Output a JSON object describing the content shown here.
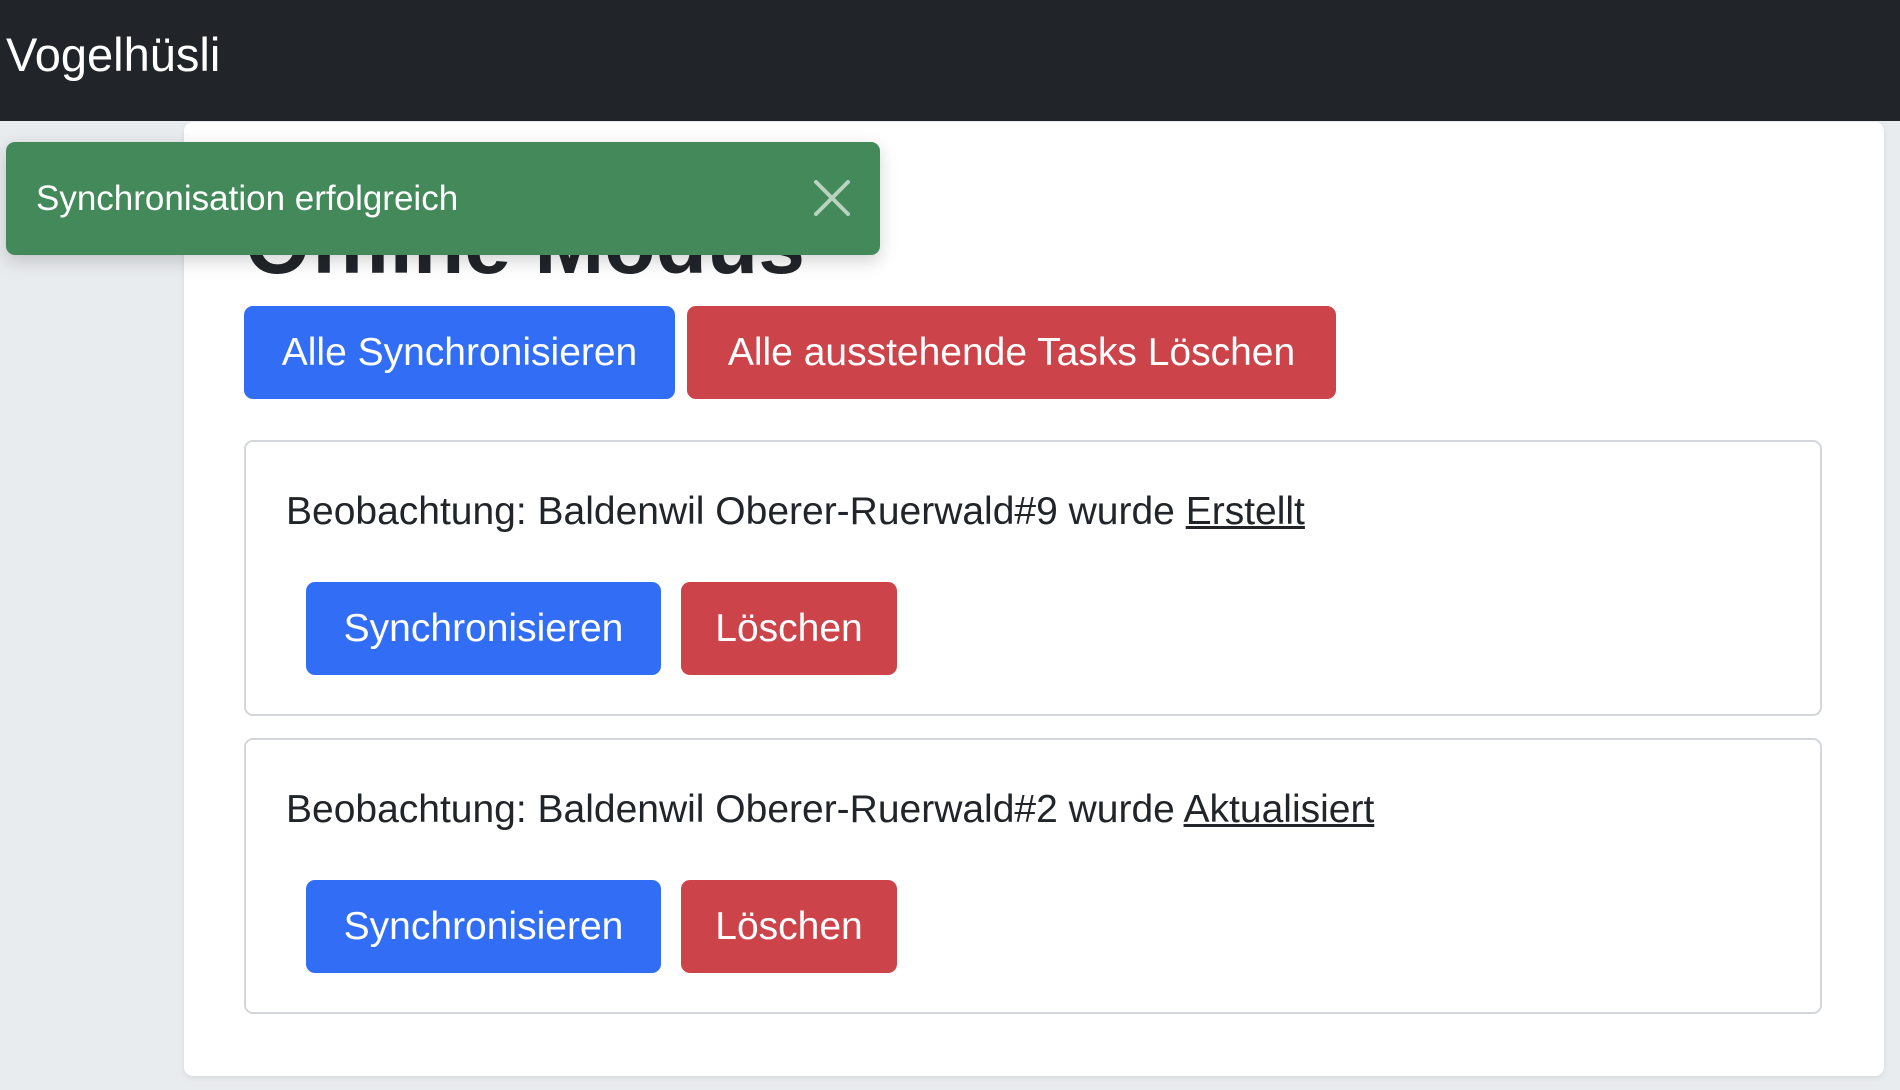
{
  "navbar": {
    "brand": "Vogelhüsli",
    "background": "#212529"
  },
  "page": {
    "title": "Offline Modus",
    "sync_all_label": "Alle Synchronisieren",
    "delete_all_label": "Alle ausstehende Tasks Löschen"
  },
  "tasks": [
    {
      "prefix": "Beobachtung: Baldenwil Oberer-Ruerwald#9 wurde",
      "action": "Erstellt",
      "sync_label": "Synchronisieren",
      "delete_label": "Löschen"
    },
    {
      "prefix": "Beobachtung: Baldenwil Oberer-Ruerwald#2 wurde",
      "action": "Aktualisiert",
      "sync_label": "Synchronisieren",
      "delete_label": "Löschen"
    }
  ],
  "toast": {
    "message": "Synchronisation erfolgreich",
    "close_icon": "close-icon",
    "color": "#43895a"
  },
  "colors": {
    "primary": "#326ef5",
    "danger": "#cc434a",
    "background": "#e9ecef"
  }
}
